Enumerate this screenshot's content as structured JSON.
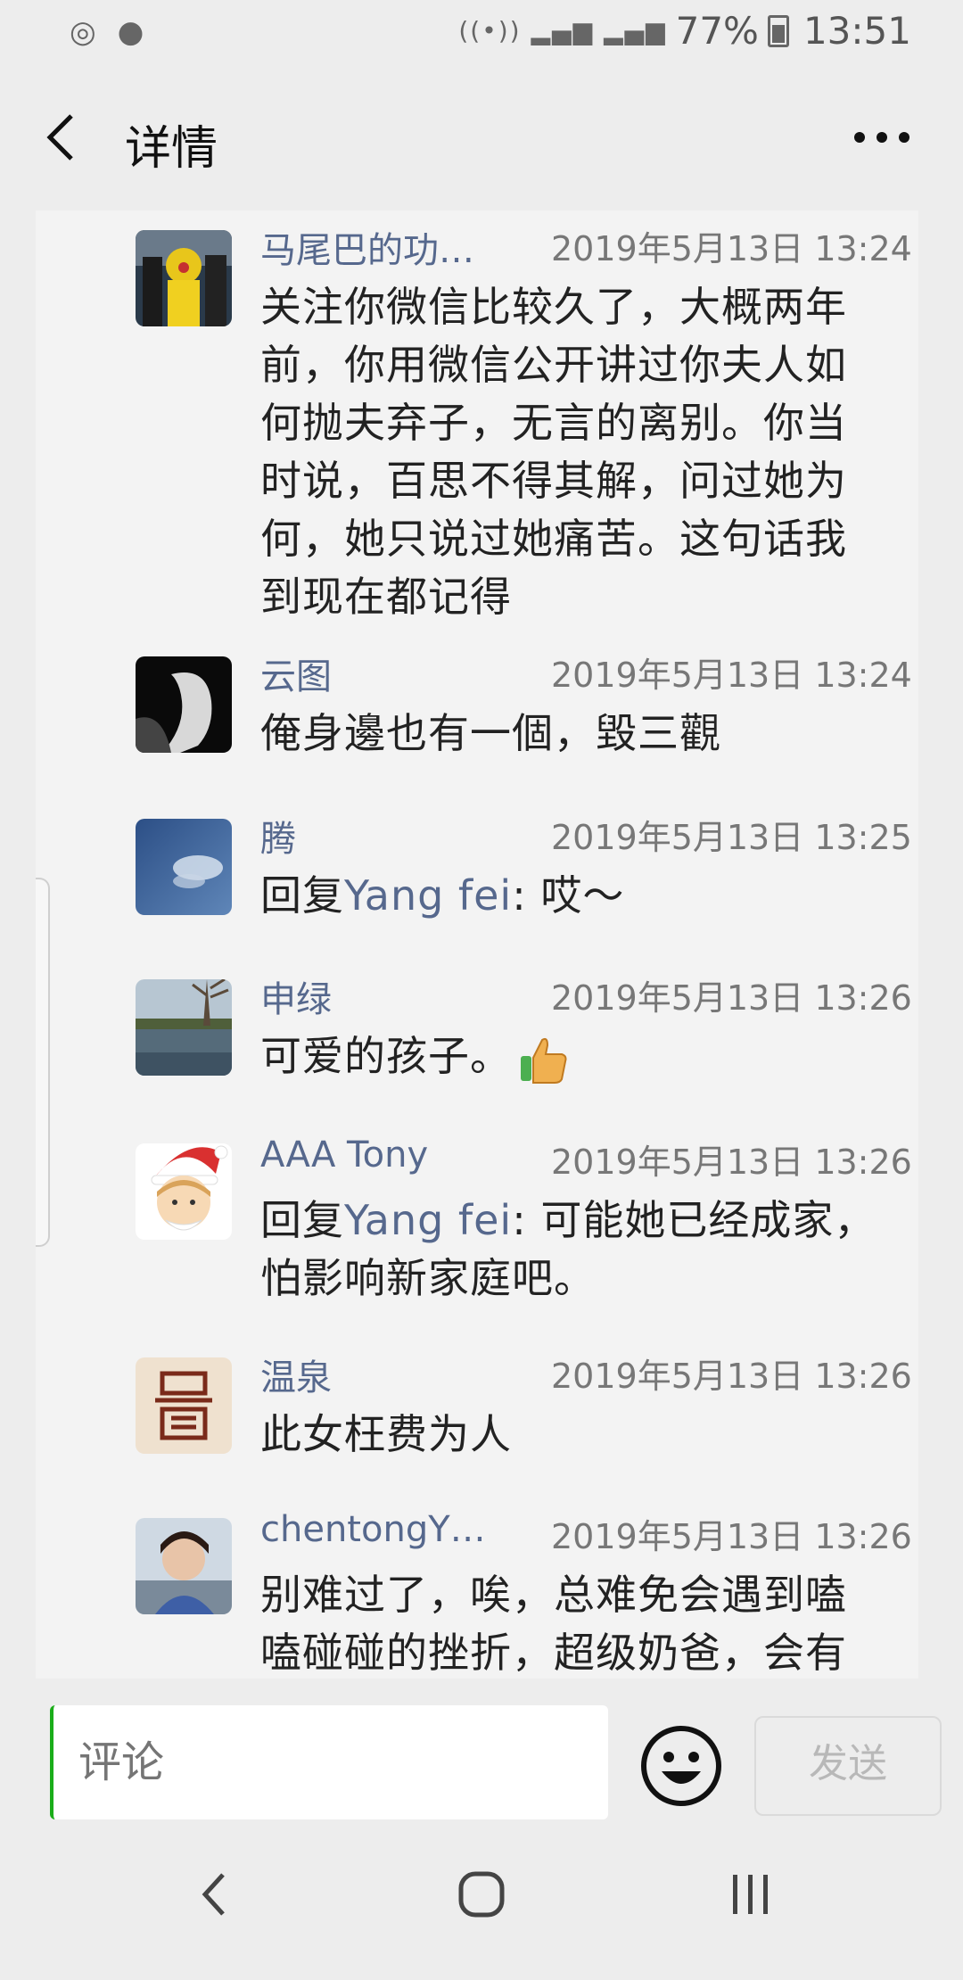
{
  "status_bar": {
    "battery": "77%",
    "time": "13:51"
  },
  "header": {
    "title": "详情"
  },
  "comments": [
    {
      "name": "马尾巴的功…",
      "time": "2019年5月13日 13:24",
      "text": "关注你微信比较久了，大概两年前，你用微信公开讲过你夫人如何抛夫弃子，无言的离别。你当时说，百思不得其解，问过她为何，她只说过她痛苦。这句话我到现在都记得"
    },
    {
      "name": "云图",
      "time": "2019年5月13日 13:24",
      "text": "俺身邊也有一個，毀三觀"
    },
    {
      "name": "腾",
      "time": "2019年5月13日 13:25",
      "reply_prefix": "回复",
      "reply_to": "Yang fei",
      "text": ": 哎～"
    },
    {
      "name": "申绿",
      "time": "2019年5月13日 13:26",
      "text": "可爱的孩子。"
    },
    {
      "name": "AAA Tony",
      "time": "2019年5月13日 13:26",
      "reply_prefix": "回复",
      "reply_to": "Yang fei",
      "text": ": 可能她已经成家，怕影响新家庭吧。"
    },
    {
      "name": "温泉",
      "time": "2019年5月13日 13:26",
      "text": "此女枉费为人"
    },
    {
      "name": "chentongY…",
      "time": "2019年5月13日 13:26",
      "text": "别难过了，唉，总难免会遇到嗑嗑碰碰的挫折，超级奶爸，会有"
    }
  ],
  "input": {
    "placeholder": "评论",
    "send_label": "发送"
  },
  "colors": {
    "name_link": "#56688d",
    "background": "#ededed"
  }
}
